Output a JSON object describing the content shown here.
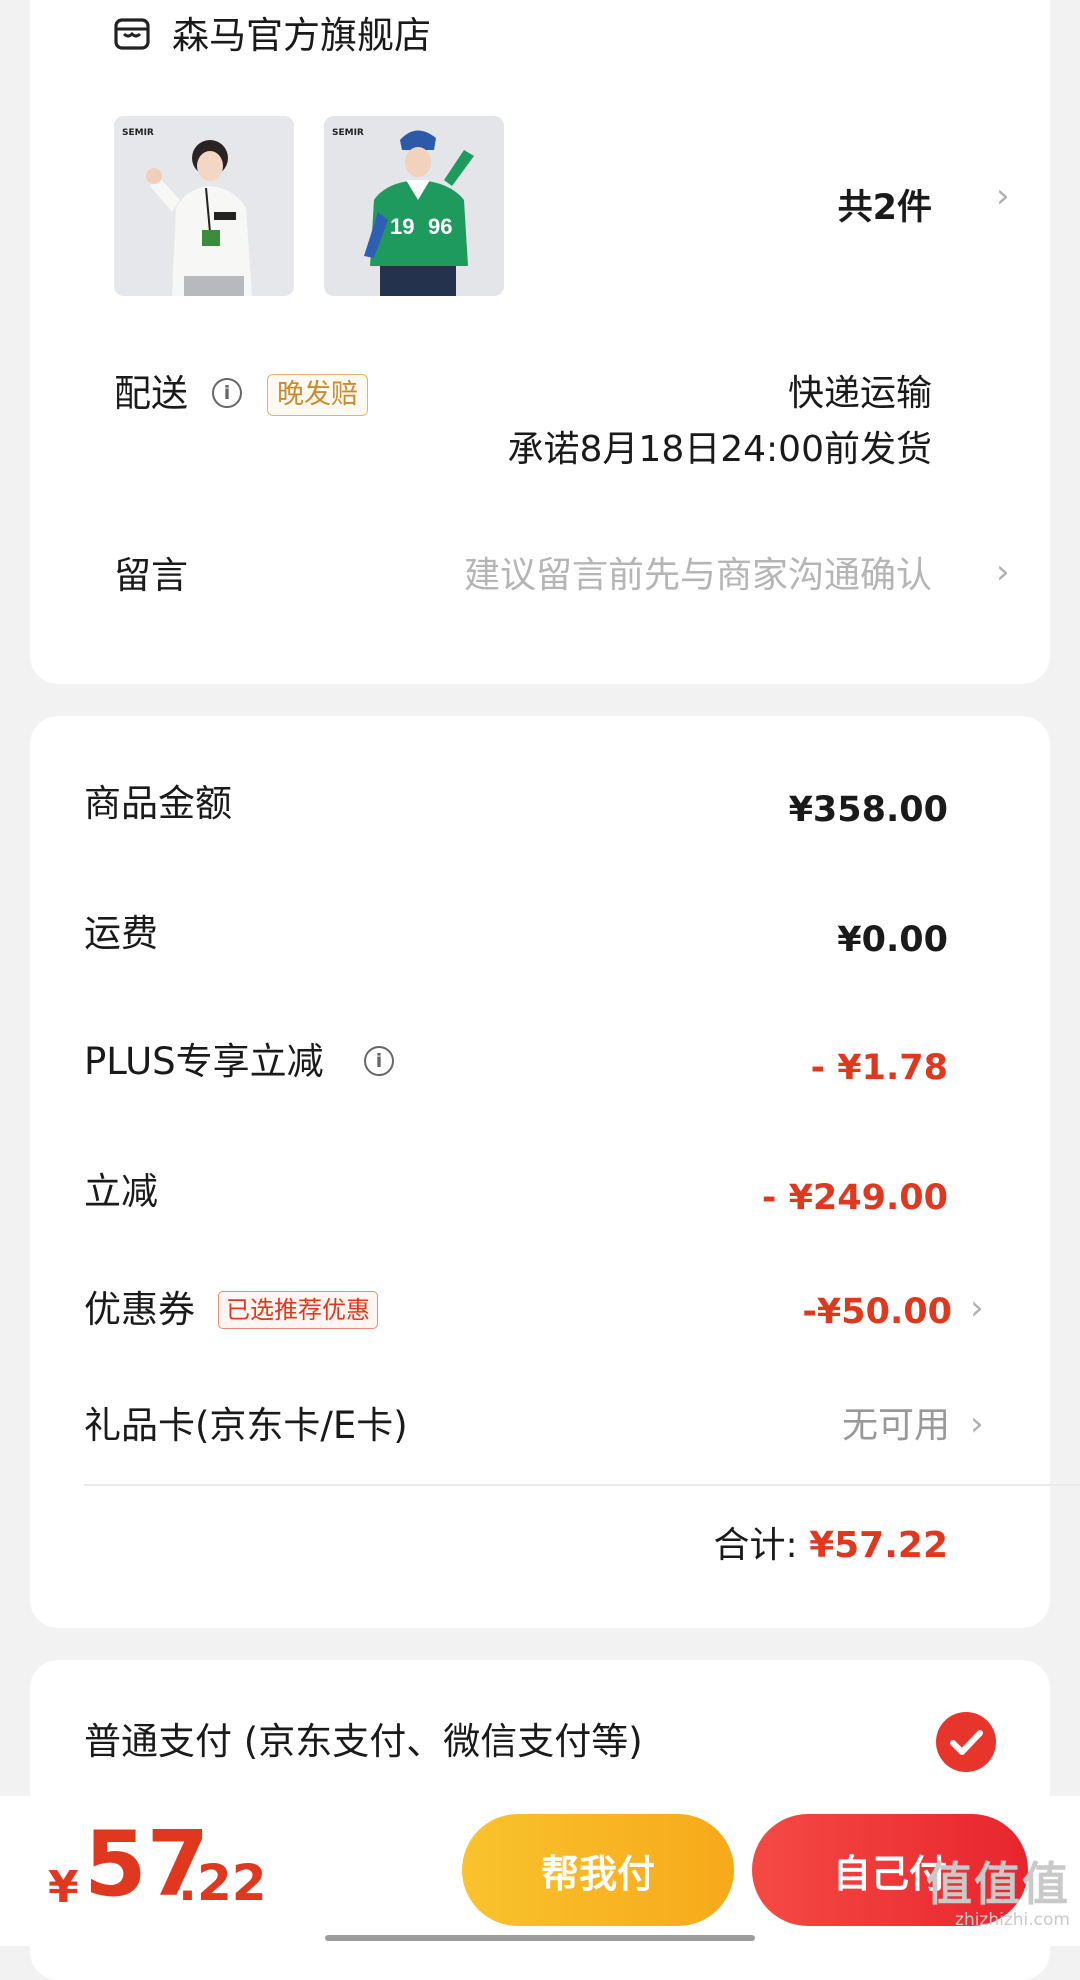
{
  "store": {
    "name": "森马官方旗舰店",
    "icon": "store-icon"
  },
  "products": {
    "thumbs": [
      {
        "tag": "SEMIR",
        "alt": "白色卫衣"
      },
      {
        "tag": "SEMIR",
        "alt": "绿色卫衣"
      }
    ],
    "count_label": "共2件"
  },
  "delivery": {
    "label": "配送",
    "badge": "晚发赔",
    "method": "快递运输",
    "promise": "承诺8月18日24:00前发货"
  },
  "message": {
    "label": "留言",
    "placeholder": "建议留言前先与商家沟通确认"
  },
  "pricing": {
    "goods_label": "商品金额",
    "goods_value": "¥358.00",
    "shipping_label": "运费",
    "shipping_value": "¥0.00",
    "plus_label": "PLUS专享立减",
    "plus_value": "- ¥1.78",
    "reduce_label": "立减",
    "reduce_value": "- ¥249.00",
    "coupon_label": "优惠券",
    "coupon_badge": "已选推荐优惠",
    "coupon_value": "-¥50.00",
    "giftcard_label": "礼品卡(京东卡/E卡)",
    "giftcard_value": "无可用",
    "total_label": "合计:",
    "total_value": "¥57.22"
  },
  "payment": {
    "method_label": "普通支付 (京东支付、微信支付等)",
    "selected": true
  },
  "bottom": {
    "currency": "¥",
    "amount_int": "57",
    "amount_dec": ".22",
    "help_pay": "帮我付",
    "self_pay": "自己付"
  },
  "watermark": {
    "big": "值值值",
    "small": "zhizhizhi.com"
  },
  "colors": {
    "accent_red": "#e0381f",
    "help_yellow": "#f9b724",
    "badge_gold": "#c98b2e"
  }
}
